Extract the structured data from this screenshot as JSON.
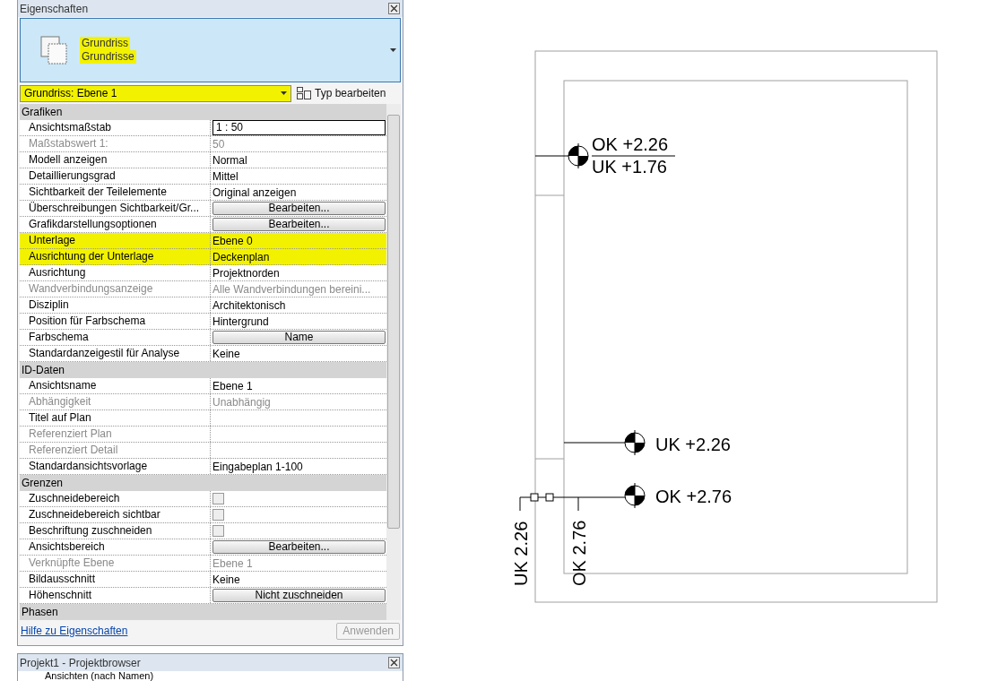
{
  "properties_panel": {
    "title": "Eigenschaften",
    "type_selector": {
      "family": "Grundriss",
      "type": "Grundrisse",
      "highlighted": true
    },
    "instance_dropdown": {
      "value": "Grundriss: Ebene 1",
      "highlighted": true
    },
    "edit_type_button": "Typ bearbeiten",
    "groups": [
      {
        "title": "Grafiken",
        "rows": [
          {
            "kind": "input",
            "label": "Ansichtsmaßstab",
            "value": "1 : 50",
            "disabled": false,
            "highlighted": false
          },
          {
            "kind": "text",
            "label": "Maßstabswert 1:",
            "value": "50",
            "disabled": true,
            "highlighted": false
          },
          {
            "kind": "text",
            "label": "Modell anzeigen",
            "value": "Normal",
            "disabled": false,
            "highlighted": false
          },
          {
            "kind": "text",
            "label": "Detaillierungsgrad",
            "value": "Mittel",
            "disabled": false,
            "highlighted": false
          },
          {
            "kind": "text",
            "label": "Sichtbarkeit der Teilelemente",
            "value": "Original anzeigen",
            "disabled": false,
            "highlighted": false
          },
          {
            "kind": "button",
            "label": "Überschreibungen Sichtbarkeit/Gr...",
            "value": "Bearbeiten...",
            "disabled": false,
            "highlighted": false
          },
          {
            "kind": "button",
            "label": "Grafikdarstellungsoptionen",
            "value": "Bearbeiten...",
            "disabled": false,
            "highlighted": false
          },
          {
            "kind": "text",
            "label": "Unterlage",
            "value": "Ebene 0",
            "disabled": false,
            "highlighted": true
          },
          {
            "kind": "text",
            "label": "Ausrichtung der Unterlage",
            "value": "Deckenplan",
            "disabled": false,
            "highlighted": true
          },
          {
            "kind": "text",
            "label": "Ausrichtung",
            "value": "Projektnorden",
            "disabled": false,
            "highlighted": false
          },
          {
            "kind": "text",
            "label": "Wandverbindungsanzeige",
            "value": "Alle Wandverbindungen bereini...",
            "disabled": true,
            "highlighted": false
          },
          {
            "kind": "text",
            "label": "Disziplin",
            "value": "Architektonisch",
            "disabled": false,
            "highlighted": false
          },
          {
            "kind": "text",
            "label": "Position für Farbschema",
            "value": "Hintergrund",
            "disabled": false,
            "highlighted": false
          },
          {
            "kind": "button",
            "label": "Farbschema",
            "value": "Name",
            "disabled": false,
            "highlighted": false
          },
          {
            "kind": "text",
            "label": "Standardanzeigestil für Analyse",
            "value": "Keine",
            "disabled": false,
            "highlighted": false
          }
        ]
      },
      {
        "title": "ID-Daten",
        "rows": [
          {
            "kind": "text",
            "label": "Ansichtsname",
            "value": "Ebene 1",
            "disabled": false,
            "highlighted": false
          },
          {
            "kind": "text",
            "label": "Abhängigkeit",
            "value": "Unabhängig",
            "disabled": true,
            "highlighted": false
          },
          {
            "kind": "text",
            "label": "Titel auf Plan",
            "disabled": false,
            "highlighted": false
          },
          {
            "kind": "text",
            "label": "Referenziert Plan",
            "disabled": true,
            "highlighted": false
          },
          {
            "kind": "text",
            "label": "Referenziert Detail",
            "disabled": true,
            "highlighted": false
          },
          {
            "kind": "text",
            "label": "Standardansichtsvorlage",
            "value": "Eingabeplan 1-100",
            "disabled": false,
            "highlighted": false
          }
        ]
      },
      {
        "title": "Grenzen",
        "rows": [
          {
            "kind": "checkbox",
            "label": "Zuschneidebereich",
            "checked": false,
            "disabled": false,
            "highlighted": false
          },
          {
            "kind": "checkbox",
            "label": "Zuschneidebereich sichtbar",
            "checked": false,
            "disabled": false,
            "highlighted": false
          },
          {
            "kind": "checkbox",
            "label": "Beschriftung zuschneiden",
            "checked": false,
            "disabled": false,
            "highlighted": false
          },
          {
            "kind": "button",
            "label": "Ansichtsbereich",
            "value": "Bearbeiten...",
            "disabled": false,
            "highlighted": false
          },
          {
            "kind": "text",
            "label": "Verknüpfte Ebene",
            "value": "Ebene 1",
            "disabled": true,
            "highlighted": false
          },
          {
            "kind": "text",
            "label": "Bildausschnitt",
            "value": "Keine",
            "disabled": false,
            "highlighted": false
          },
          {
            "kind": "button",
            "label": "Höhenschnitt",
            "value": "Nicht zuschneiden",
            "disabled": false,
            "highlighted": false
          }
        ]
      },
      {
        "title": "Phasen"
      }
    ],
    "help_link": "Hilfe zu Eigenschaften",
    "apply_button": {
      "label": "Anwenden",
      "disabled": true
    }
  },
  "project_browser": {
    "title": "Projekt1 - Projektbrowser",
    "items": [
      {
        "label": "Ansichten (nach Namen)"
      }
    ]
  },
  "drawing": {
    "level_labels": [
      "OK +2.26",
      "UK +1.76",
      "UK +2.26",
      "OK +2.76"
    ],
    "vertical_labels": [
      "UK 2.26",
      "OK 2.76"
    ]
  }
}
